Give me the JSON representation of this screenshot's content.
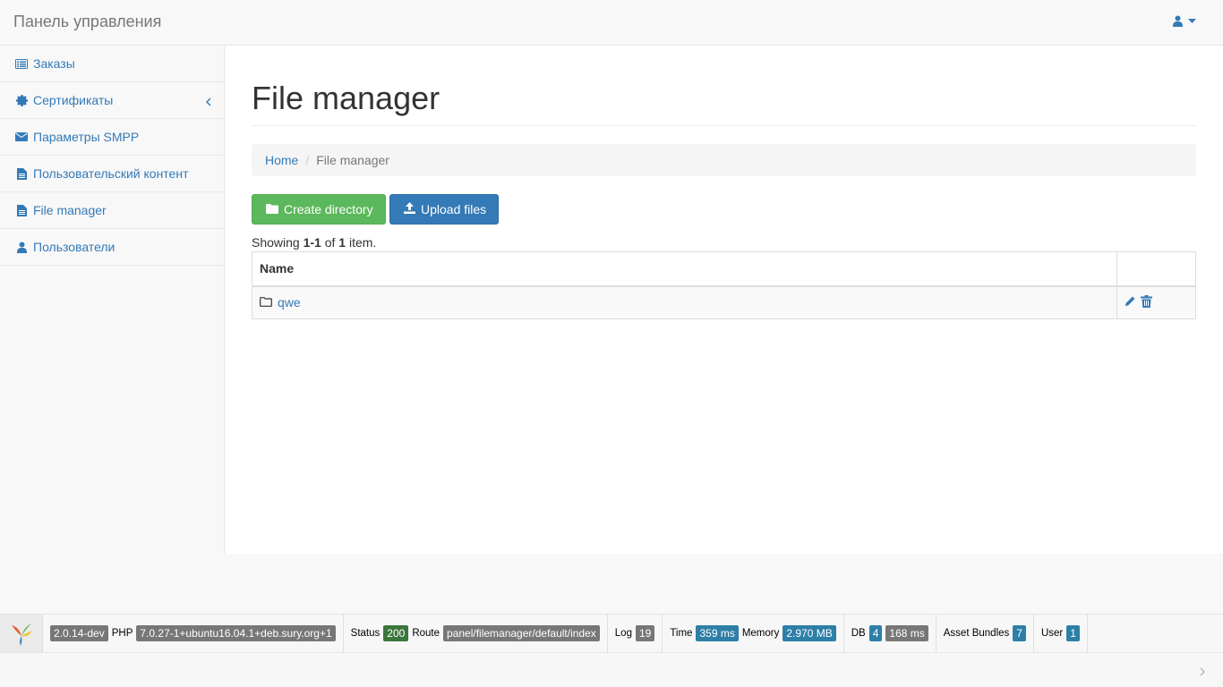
{
  "navbar": {
    "brand": "Панель управления",
    "user_icon": "user-icon"
  },
  "sidebar": {
    "items": [
      {
        "label": "Заказы",
        "icon": "list-icon"
      },
      {
        "label": "Сертификаты",
        "icon": "certificate-icon"
      },
      {
        "label": "Параметры SMPP",
        "icon": "envelope-icon"
      },
      {
        "label": "Пользовательский контент",
        "icon": "file-icon"
      },
      {
        "label": "File manager",
        "icon": "file-icon"
      },
      {
        "label": "Пользователи",
        "icon": "user-icon"
      }
    ]
  },
  "main": {
    "title": "File manager",
    "breadcrumb": {
      "home": "Home",
      "current": "File manager"
    },
    "buttons": {
      "create": "Create directory",
      "upload": "Upload files"
    },
    "summary": {
      "prefix": "Showing ",
      "range": "1-1",
      "of": " of ",
      "total": "1",
      "suffix": " item."
    },
    "table": {
      "header_name": "Name",
      "rows": [
        {
          "name": "qwe",
          "type": "folder"
        }
      ]
    }
  },
  "debug": {
    "version": "2.0.14-dev",
    "php_label": "PHP",
    "php_version": "7.0.27-1+ubuntu16.04.1+deb.sury.org+1",
    "status_label": "Status",
    "status_value": "200",
    "route_label": "Route",
    "route_value": "panel/filemanager/default/index",
    "log_label": "Log",
    "log_value": "19",
    "time_label": "Time",
    "time_value": "359 ms",
    "memory_label": "Memory",
    "memory_value": "2.970 MB",
    "db_label": "DB",
    "db_count": "4",
    "db_time": "168 ms",
    "assets_label": "Asset Bundles",
    "assets_value": "7",
    "user_label": "User",
    "user_value": "1"
  },
  "colors": {
    "link": "#337ab7",
    "success": "#5cb85c",
    "primary": "#337ab7",
    "status_ok": "#3c763d",
    "info": "#2d7fa8"
  }
}
